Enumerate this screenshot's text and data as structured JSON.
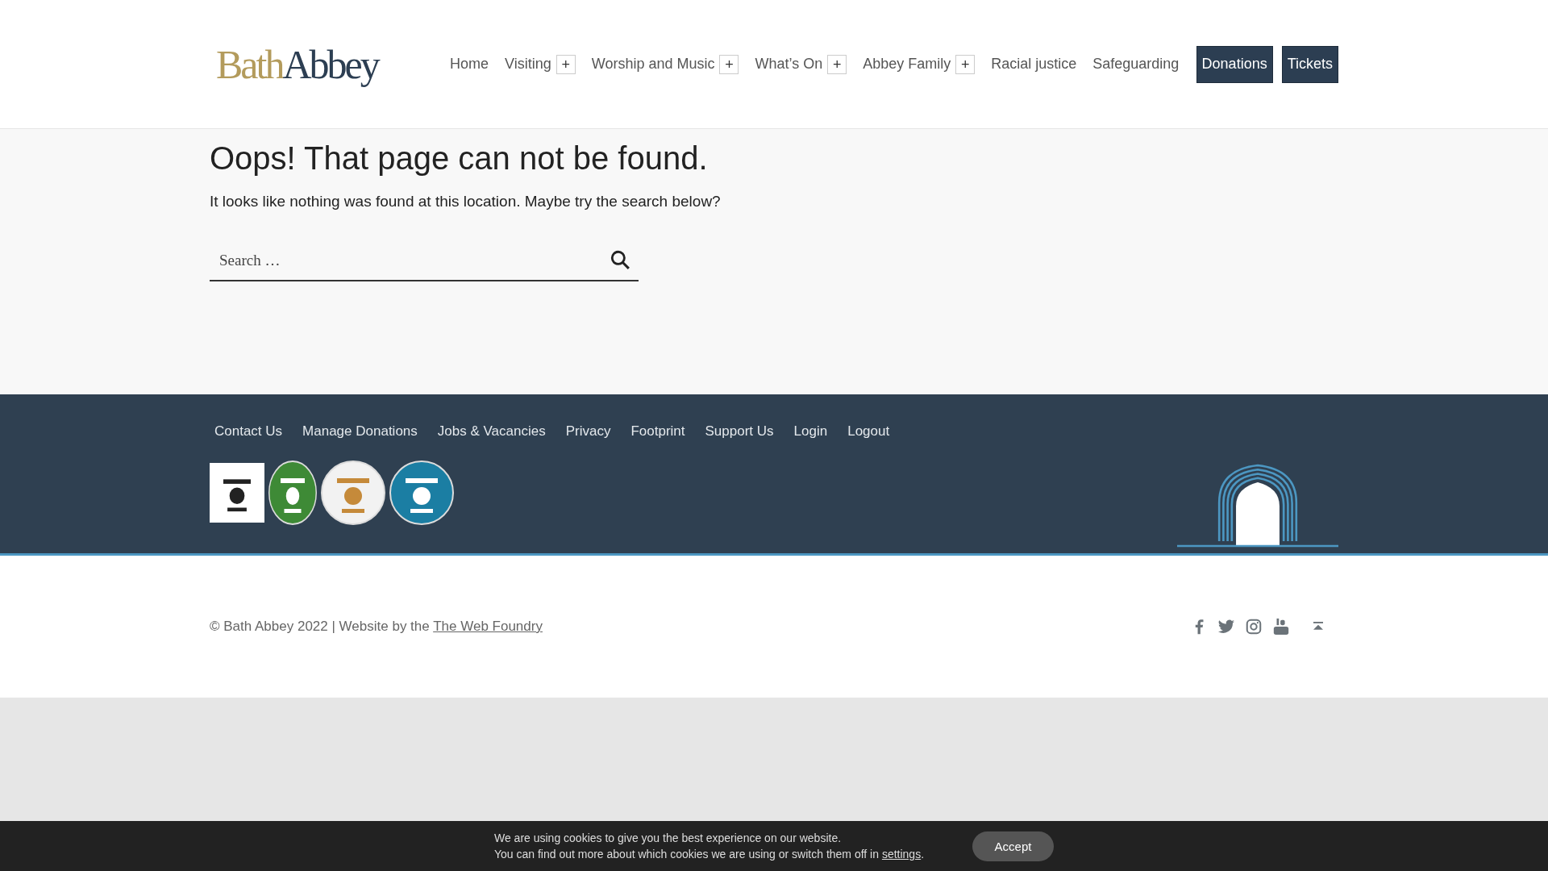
{
  "logo": {
    "first": "Bath",
    "second": "Abbey"
  },
  "nav": [
    {
      "label": "Home",
      "expandable": false
    },
    {
      "label": "Visiting",
      "expandable": true
    },
    {
      "label": "Worship and Music",
      "expandable": true
    },
    {
      "label": "What’s On",
      "expandable": true
    },
    {
      "label": "Abbey Family",
      "expandable": true
    },
    {
      "label": "Racial justice",
      "expandable": false
    },
    {
      "label": "Safeguarding",
      "expandable": false
    }
  ],
  "expand_symbol": "+",
  "header_buttons": [
    "Donations",
    "Tickets"
  ],
  "main": {
    "title": "Oops! That page can not be found.",
    "text": "It looks like nothing was found at this location. Maybe try the search below?",
    "search": {
      "placeholder": "Search …"
    }
  },
  "footer_links": [
    "Contact Us",
    "Manage Donations",
    "Jobs & Vacancies",
    "Privacy",
    "Footprint",
    "Support Us",
    "Login",
    "Logout"
  ],
  "badges": [
    {
      "kind": "square"
    },
    {
      "kind": "oval"
    },
    {
      "kind": "round"
    },
    {
      "kind": "disc"
    }
  ],
  "copyright": {
    "text": "© Bath Abbey 2022 | Website by the",
    "link": "The Web Foundry"
  },
  "social": [
    {
      "kind": "facebook"
    },
    {
      "kind": "twitter"
    },
    {
      "kind": "instagram"
    },
    {
      "kind": "youtube"
    },
    {
      "kind": "top"
    }
  ],
  "cookie": {
    "line1": "We are using cookies to give you the best experience on our website.",
    "line2": "You can find out more about which cookies we are using or switch them off in",
    "link": "settings",
    "after": ".",
    "button": "Accept"
  }
}
